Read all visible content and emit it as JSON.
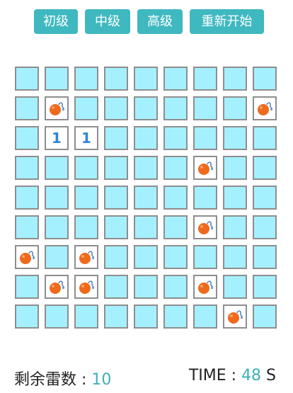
{
  "toolbar": {
    "buttons": [
      "初级",
      "中级",
      "高级",
      "重新开始"
    ]
  },
  "board": {
    "rows": 9,
    "cols": 9,
    "cells": [
      [
        "h",
        "h",
        "h",
        "h",
        "h",
        "h",
        "h",
        "h",
        "h"
      ],
      [
        "h",
        "m",
        "h",
        "h",
        "h",
        "h",
        "h",
        "h",
        "m"
      ],
      [
        "h",
        "1",
        "1",
        "h",
        "h",
        "h",
        "h",
        "h",
        "h"
      ],
      [
        "h",
        "h",
        "h",
        "h",
        "h",
        "h",
        "m",
        "h",
        "h"
      ],
      [
        "h",
        "h",
        "h",
        "h",
        "h",
        "h",
        "h",
        "h",
        "h"
      ],
      [
        "h",
        "h",
        "h",
        "h",
        "h",
        "h",
        "m",
        "h",
        "h"
      ],
      [
        "m",
        "h",
        "m",
        "h",
        "h",
        "h",
        "h",
        "h",
        "h"
      ],
      [
        "h",
        "m",
        "m",
        "h",
        "h",
        "h",
        "m",
        "h",
        "h"
      ],
      [
        "h",
        "h",
        "h",
        "h",
        "h",
        "h",
        "h",
        "m",
        "h"
      ]
    ]
  },
  "footer": {
    "mines_label": "剩余雷数 : ",
    "mines_value": "10",
    "time_label": "TIME : ",
    "time_value": "48",
    "time_unit": " S"
  },
  "colors": {
    "accent": "#3fb8c0",
    "cell_hidden": "#a5f0ff",
    "number": "#2f86d6",
    "mine": "#ee6a1c"
  }
}
